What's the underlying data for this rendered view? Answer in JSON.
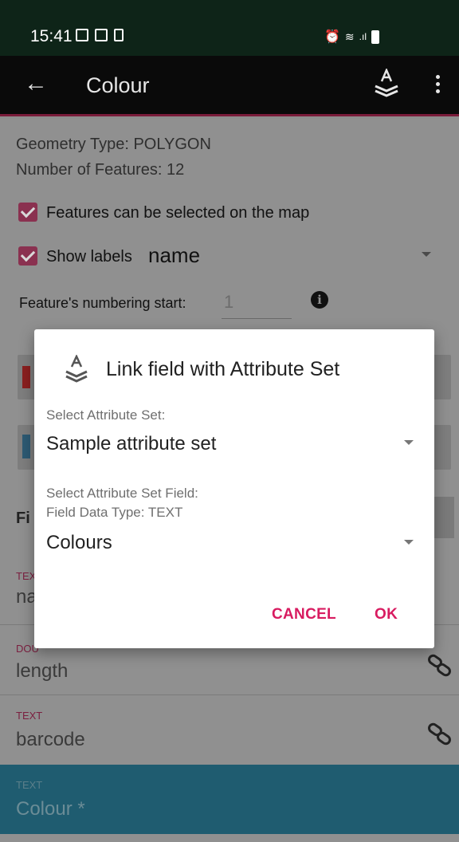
{
  "status_bar": {
    "time": "15:41"
  },
  "toolbar": {
    "title": "Colour",
    "back_icon": "arrow-back-icon",
    "layers_icon": "layers-icon",
    "menu_icon": "more-vert-icon"
  },
  "info": {
    "geometry_type": "Geometry Type: POLYGON",
    "feature_count": "Number of Features: 12"
  },
  "options": {
    "selectable_label": "Features can be selected on the map",
    "show_labels_label": "Show labels",
    "label_field_value": "name",
    "numbering_label": "Feature's numbering start:",
    "numbering_value": "1"
  },
  "fields": [
    {
      "type": "TEXT",
      "name": "na"
    },
    {
      "type": "DOU",
      "name": "length"
    },
    {
      "type": "TEXT",
      "name": "barcode"
    },
    {
      "type": "TEXT",
      "name": "Colour *"
    }
  ],
  "fields_header_partial": "Fi",
  "dialog": {
    "title": "Link field with Attribute Set",
    "attr_set_label": "Select Attribute Set:",
    "attr_set_value": "Sample attribute set",
    "field_label": "Select Attribute Set Field:",
    "field_type_label": "Field Data Type: TEXT",
    "field_value": "Colours",
    "cancel": "CANCEL",
    "ok": "OK"
  },
  "colors": {
    "accent": "#d81b60",
    "selected_row": "#1f5c70",
    "toolbar": "#0a0a0a",
    "statusbar": "#0e2418"
  }
}
